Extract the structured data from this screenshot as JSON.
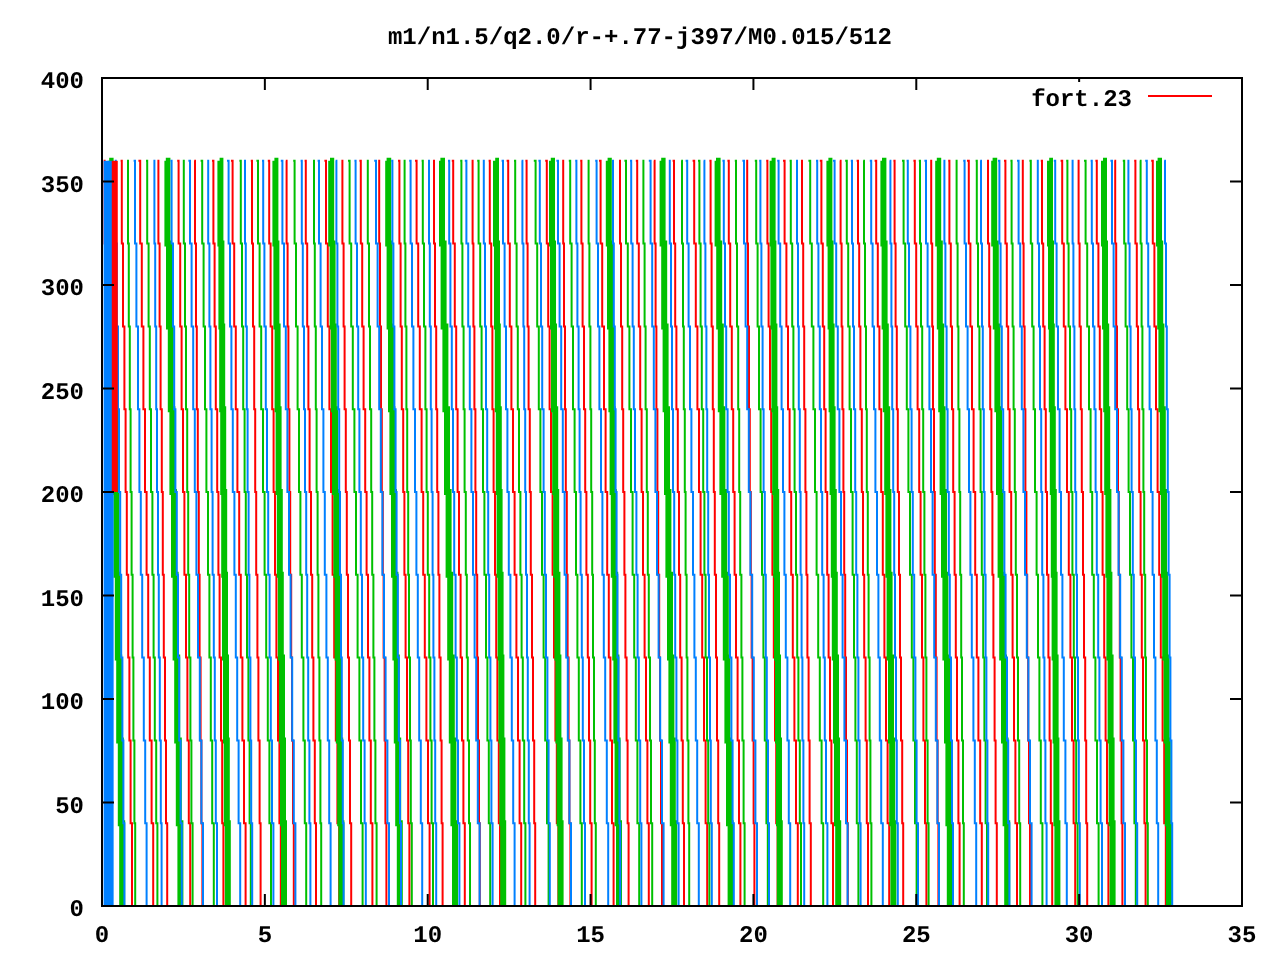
{
  "chart": {
    "title": "m1/n1.5/q2.0/r-+.77-j397/M0.015/512",
    "y_ticks": [
      "400",
      "350",
      "300",
      "250",
      "200",
      "150",
      "100",
      "50",
      "0"
    ],
    "x_ticks": [
      "0",
      "5",
      "10",
      "15",
      "20",
      "25",
      "30",
      "35"
    ],
    "legend": {
      "label": "fort.23"
    }
  }
}
